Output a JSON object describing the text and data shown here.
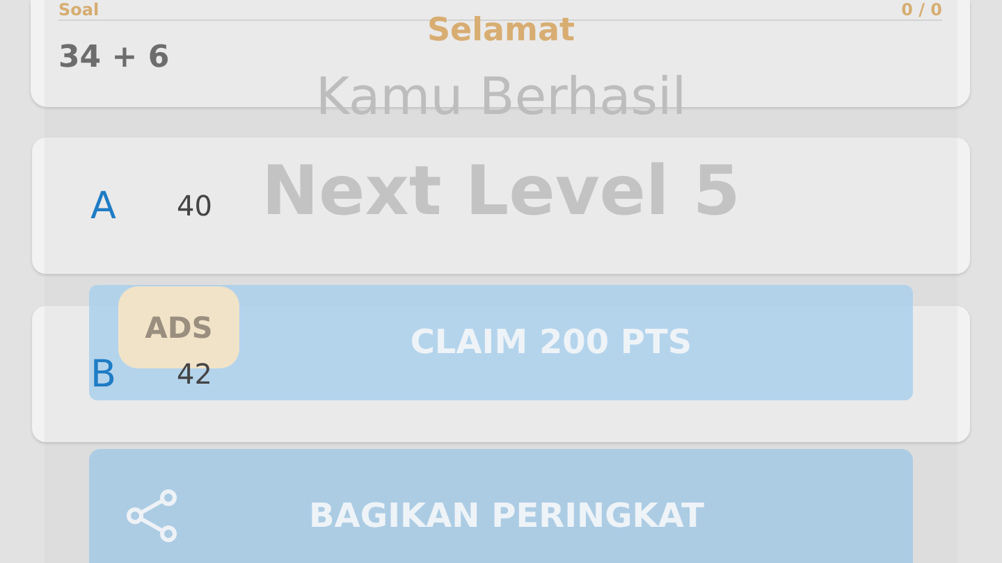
{
  "question_card": {
    "label": "Soal",
    "counter": "0 / 0",
    "question": "34 + 6"
  },
  "answers": [
    {
      "letter": "A",
      "value": "40"
    },
    {
      "letter": "B",
      "value": "42"
    }
  ],
  "dialog": {
    "greeting": "Selamat",
    "message": "Kamu Berhasil",
    "level_text": "Next Level 5",
    "claim_button": {
      "badge": "ADS",
      "label": "CLAIM 200 PTS"
    },
    "share_button": {
      "label": "BAGIKAN PERINGKAT"
    }
  }
}
